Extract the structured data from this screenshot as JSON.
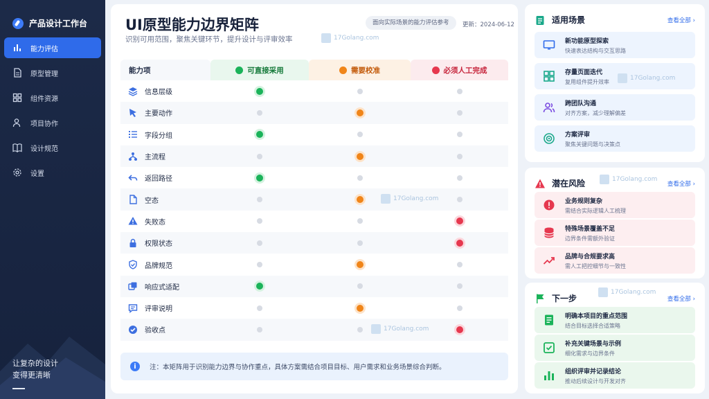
{
  "app": {
    "title": "产品设计工作台",
    "slogan_line1": "让复杂的设计",
    "slogan_line2": "变得更清晰"
  },
  "nav": [
    {
      "label": "能力评估",
      "icon": "bar-chart-icon",
      "active": true
    },
    {
      "label": "原型管理",
      "icon": "document-icon",
      "active": false
    },
    {
      "label": "组件资源",
      "icon": "grid-icon",
      "active": false
    },
    {
      "label": "项目协作",
      "icon": "users-icon",
      "active": false
    },
    {
      "label": "设计规范",
      "icon": "book-icon",
      "active": false
    },
    {
      "label": "设置",
      "icon": "gear-icon",
      "active": false
    }
  ],
  "header": {
    "title": "UI原型能力边界矩阵",
    "subtitle": "识别可用范围，聚焦关键环节，提升设计与评审效率",
    "scene_pill": "面向实际场景的能力评估参考",
    "updated": "更新：2024-06-12"
  },
  "table": {
    "col0": "能力项",
    "columns": [
      {
        "label": "可直接采用",
        "color": "#1bb35a"
      },
      {
        "label": "需要校准",
        "color": "#f08519"
      },
      {
        "label": "必须人工完成",
        "color": "#e6384f"
      }
    ],
    "rows": [
      {
        "label": "信息层级",
        "icon": "layers-icon",
        "level": 0
      },
      {
        "label": "主要动作",
        "icon": "cursor-icon",
        "level": 1
      },
      {
        "label": "字段分组",
        "icon": "list-icon",
        "level": 0
      },
      {
        "label": "主流程",
        "icon": "flow-icon",
        "level": 1
      },
      {
        "label": "返回路径",
        "icon": "return-arrow-icon",
        "level": 0
      },
      {
        "label": "空态",
        "icon": "file-icon",
        "level": 1
      },
      {
        "label": "失败态",
        "icon": "warning-icon",
        "level": 2
      },
      {
        "label": "权限状态",
        "icon": "lock-icon",
        "level": 2
      },
      {
        "label": "品牌规范",
        "icon": "shield-icon",
        "level": 1
      },
      {
        "label": "响应式适配",
        "icon": "copy-icon",
        "level": 0
      },
      {
        "label": "评审说明",
        "icon": "comment-icon",
        "level": 1
      },
      {
        "label": "验收点",
        "icon": "check-circle-icon",
        "level": 2
      }
    ]
  },
  "note": "注：本矩阵用于识别能力边界与协作重点，具体方案需结合项目目标、用户需求和业务场景综合判断。",
  "panels": {
    "scenes": {
      "title": "适用场景",
      "more": "查看全部 ›",
      "items": [
        {
          "title": "新功能原型探索",
          "sub": "快速表达结构与交互思路",
          "icon": "monitor-icon"
        },
        {
          "title": "存量页面迭代",
          "sub": "复用组件提升效率",
          "icon": "grid-icon"
        },
        {
          "title": "跨团队沟通",
          "sub": "对齐方案，减少理解偏差",
          "icon": "team-icon"
        },
        {
          "title": "方案评审",
          "sub": "聚焦关键问题与决策点",
          "icon": "target-icon"
        }
      ]
    },
    "risks": {
      "title": "潜在风险",
      "more": "查看全部 ›",
      "items": [
        {
          "title": "业务规则复杂",
          "sub": "需结合实际逻辑人工梳理",
          "icon": "alert-icon"
        },
        {
          "title": "特殊场景覆盖不足",
          "sub": "边界条件需额外验证",
          "icon": "database-icon"
        },
        {
          "title": "品牌与合规要求高",
          "sub": "需人工把控细节与一致性",
          "icon": "trend-icon"
        }
      ]
    },
    "next": {
      "title": "下一步",
      "more": "查看全部 ›",
      "items": [
        {
          "title": "明确本项目的重点范围",
          "sub": "结合目标选择合适策略",
          "icon": "doc-icon"
        },
        {
          "title": "补充关键场景与示例",
          "sub": "细化需求与边界条件",
          "icon": "checkbox-icon"
        },
        {
          "title": "组织评审并记录结论",
          "sub": "推动后续设计与开发对齐",
          "icon": "chart-icon"
        }
      ]
    }
  },
  "watermark": "17Golang.com"
}
